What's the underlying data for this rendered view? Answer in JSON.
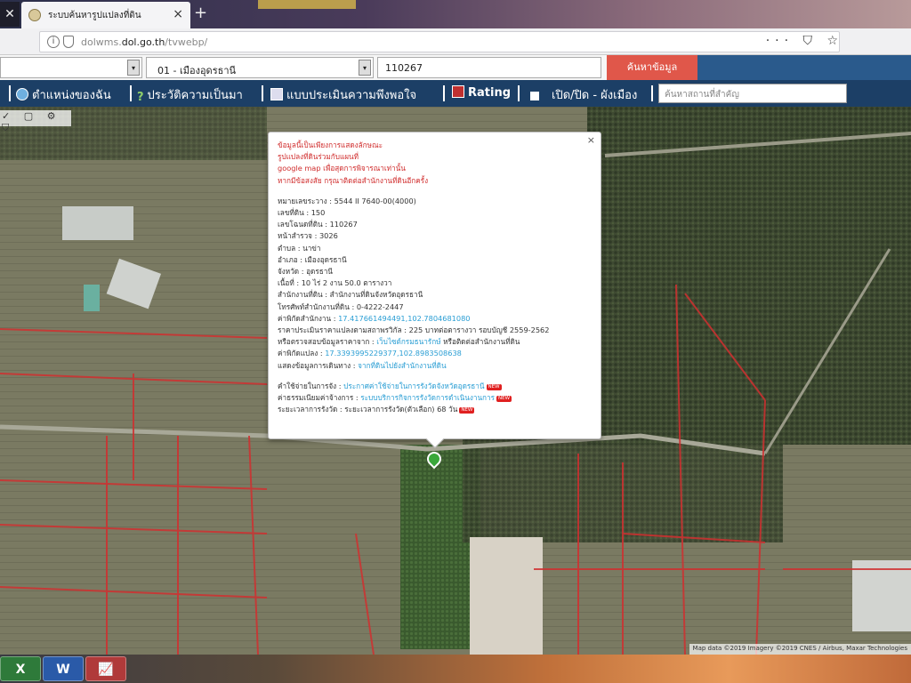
{
  "browser": {
    "tab_title": "ระบบค้นหารูปแปลงที่ดิน",
    "tab_close": "×",
    "new_tab": "+",
    "left_close": "✕",
    "url_prefix": "dolwms.",
    "url_domain": "dol.go.th",
    "url_suffix": "/tvwebp/",
    "nav_icons": "··· ⛉ ☆"
  },
  "search": {
    "district": "01 - เมืองอุดรธานี",
    "parcel_id": "110267",
    "button": "ค้นหาข้อมูล"
  },
  "menu": {
    "location": "ตำแหน่งของฉัน",
    "history": "ประวัติความเป็นมา",
    "assessment": "แบบประเมินความพึงพอใจ",
    "rating": "Rating",
    "toggle_layer": "เปิด/ปิด - ผังเมือง",
    "search_placeholder": "ค้นหาสถานที่สำคัญ"
  },
  "map": {
    "tools": "✓ ▢ ⚙ ⛉",
    "attribution": "Map data ©2019 Imagery ©2019 CNES / Airbus, Maxar Technologies"
  },
  "popup": {
    "close": "×",
    "note_lines": [
      "ข้อมูลนี้เป็นเพียงการแสดงลักษณะ",
      "รูปแปลงที่ดินร่วมกับแผนที่",
      "google map เพื่อสุดการพิจารณาเท่านั้น",
      "หากมีข้อสงสัย กรุณาติดต่อสำนักงานที่ดินอีกครั้ง"
    ],
    "fields": [
      {
        "label": "หมายเลขระวาง",
        "value": "5544 II 7640-00(4000)"
      },
      {
        "label": "เลขที่ดิน",
        "value": "150"
      },
      {
        "label": "เลขโฉนดที่ดิน",
        "value": "110267"
      },
      {
        "label": "หน้าสำรวจ",
        "value": "3026"
      },
      {
        "label": "ตำบล",
        "value": "นาข่า"
      },
      {
        "label": "อำเภอ",
        "value": "เมืองอุดรธานี"
      },
      {
        "label": "จังหวัด",
        "value": "อุดรธานี"
      },
      {
        "label": "เนื้อที่",
        "value": "10 ไร่ 2 งาน 50.0 ตารางวา"
      },
      {
        "label": "สำนักงานที่ดิน",
        "value": "สำนักงานที่ดินจังหวัดอุดรธานี"
      },
      {
        "label": "โทรศัพท์สำนักงานที่ดิน",
        "value": "0-4222-2447"
      }
    ],
    "office_coord_label": "ค่าพิกัดสำนักงาน",
    "office_coord": "17.417661494491,102.7804681080",
    "price_label": "ราคาประเมินราคาแปลงตามสถาพรวิกัล",
    "price_value": "225 บาทต่อตารางวา รอบบัญชี 2559-2562",
    "verify_label": "หรือตรวจสอบข้อมูลราคาจาก",
    "verify_link": "เว็บไซต์กรมธนารักษ์",
    "verify_tail": "หรือติดต่อสำนักงานที่ดิน",
    "parcel_coord_label": "ค่าพิกัดแปลง",
    "parcel_coord": "17.3393995229377,102.8983508638",
    "more_label": "แสดงข้อมูลการเดินทาง",
    "more_link": "จากที่ดินไปยังสำนักงานที่ดิน",
    "service_label": "คำใช้จ่ายในการจัง",
    "service_link": "ประกาศค่าใช้จ่ายในการรังวัดจังหวัดอุดรธานี",
    "fee_label": "ค่าธรรมเนียมค่าจ้างการ",
    "fee_link": "ระบบบริการกิจการรังวัดการดำเนินงานการ",
    "time_label": "ระยะเวลาการรังวัด",
    "time_value": "ระยะเวลาการรังวัด(ตัวเลือก) 68 วัน",
    "new_tag": "NEW"
  },
  "taskbar": {
    "apps": [
      "X",
      "W",
      "📈"
    ]
  }
}
